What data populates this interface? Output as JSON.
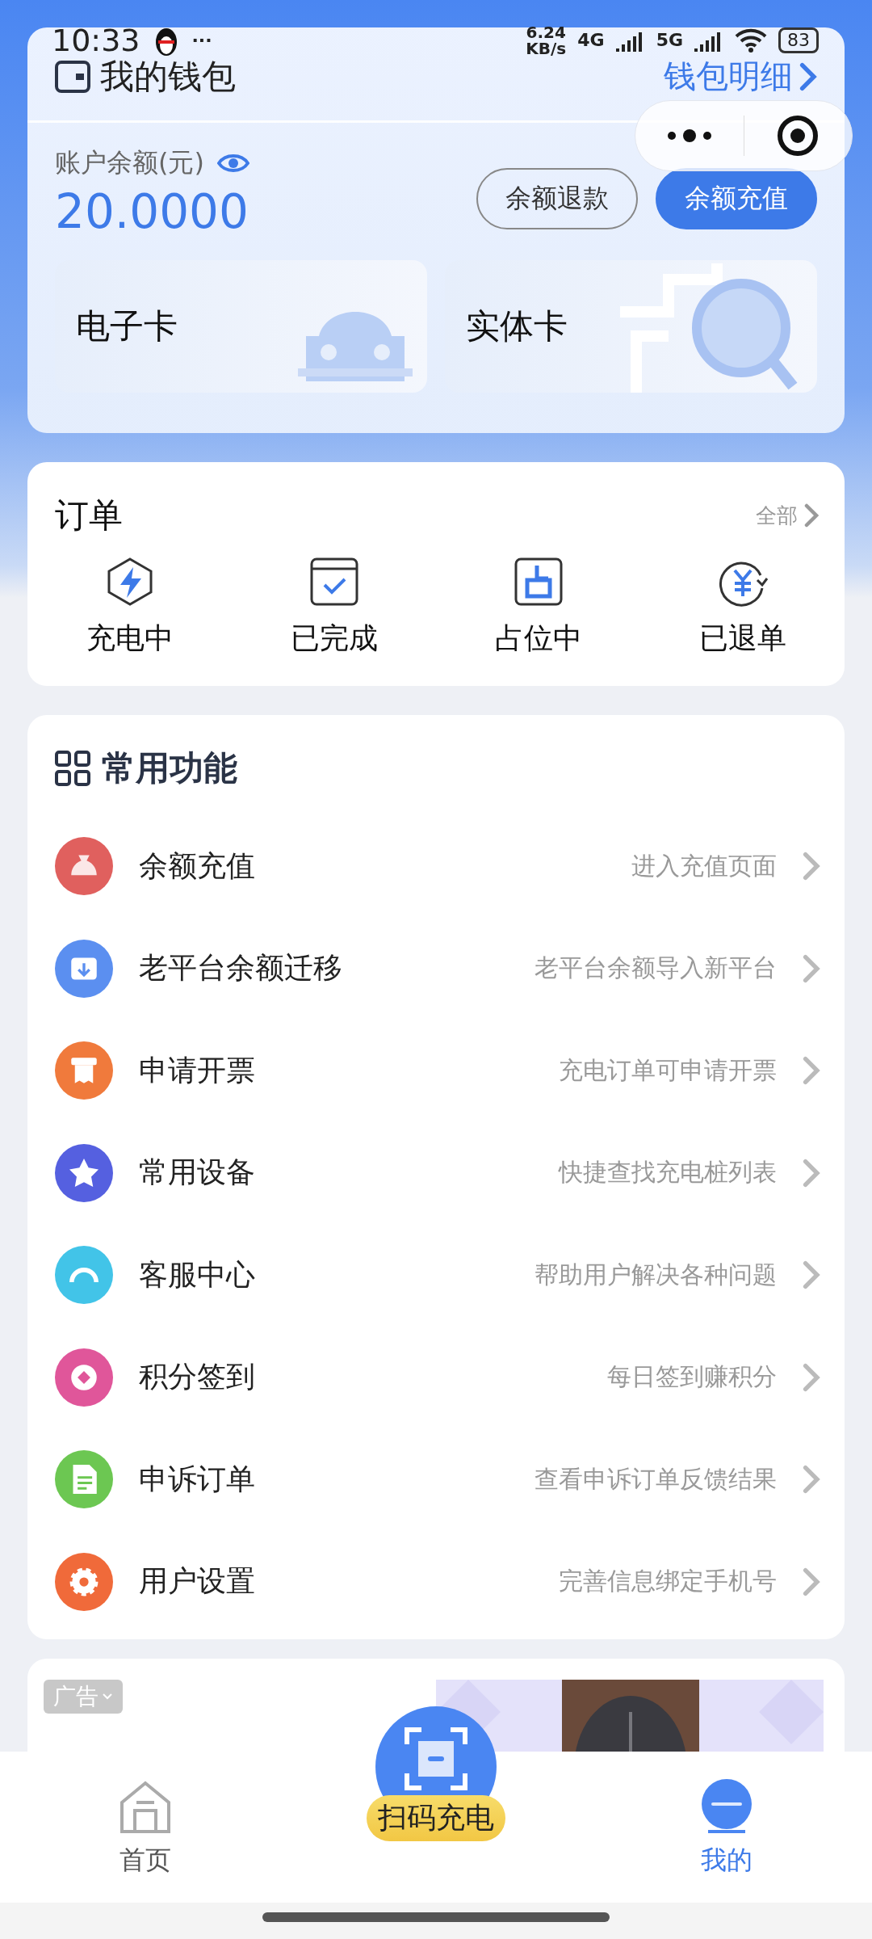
{
  "status_bar": {
    "time": "10:33",
    "more": "···",
    "speed": "6.24",
    "speed_unit": "KB/s",
    "network_1": "4G",
    "network_2": "5G",
    "battery": "83"
  },
  "wallet": {
    "title": "我的钱包",
    "detail_link": "钱包明细",
    "balance_label": "账户余额(元)",
    "balance": "20.0000",
    "buttons": [
      {
        "label": "余额退款",
        "kind": "outline"
      },
      {
        "label": "余额充值",
        "kind": "primary"
      }
    ],
    "cards": [
      {
        "label": "电子卡",
        "kind": "car"
      },
      {
        "label": "实体卡",
        "kind": "search"
      }
    ]
  },
  "orders": {
    "title": "订单",
    "all_link": "全部",
    "items": [
      {
        "label": "充电中",
        "kind": "bolt"
      },
      {
        "label": "已完成",
        "kind": "check"
      },
      {
        "label": "占位中",
        "kind": "occupy"
      },
      {
        "label": "已退单",
        "kind": "refund"
      }
    ]
  },
  "functions": {
    "title": "常用功能",
    "items": [
      {
        "label": "余额充值",
        "hint": "进入充值页面",
        "color": "#e0605e",
        "kind": "bag"
      },
      {
        "label": "老平台余额迁移",
        "hint": "老平台余额导入新平台",
        "color": "#5b8ff0",
        "kind": "import"
      },
      {
        "label": "申请开票",
        "hint": "充电订单可申请开票",
        "color": "#f07a3c",
        "kind": "invoice"
      },
      {
        "label": "常用设备",
        "hint": "快捷查找充电桩列表",
        "color": "#5560e0",
        "kind": "star"
      },
      {
        "label": "客服中心",
        "hint": "帮助用户解决各种问题",
        "color": "#42c4e8",
        "kind": "service"
      },
      {
        "label": "积分签到",
        "hint": "每日签到赚积分",
        "color": "#e0569a",
        "kind": "points"
      },
      {
        "label": "申诉订单",
        "hint": "查看申诉订单反馈结果",
        "color": "#6cc752",
        "kind": "doc"
      },
      {
        "label": "用户设置",
        "hint": "完善信息绑定手机号",
        "color": "#f06a3a",
        "kind": "gear"
      }
    ]
  },
  "ad": {
    "badge": "广告"
  },
  "nav": [
    {
      "label": "首页",
      "kind": "home",
      "selected": false
    },
    {
      "label": "扫码充电",
      "kind": "scan",
      "selected": false
    },
    {
      "label": "我的",
      "kind": "profile",
      "selected": true
    }
  ]
}
